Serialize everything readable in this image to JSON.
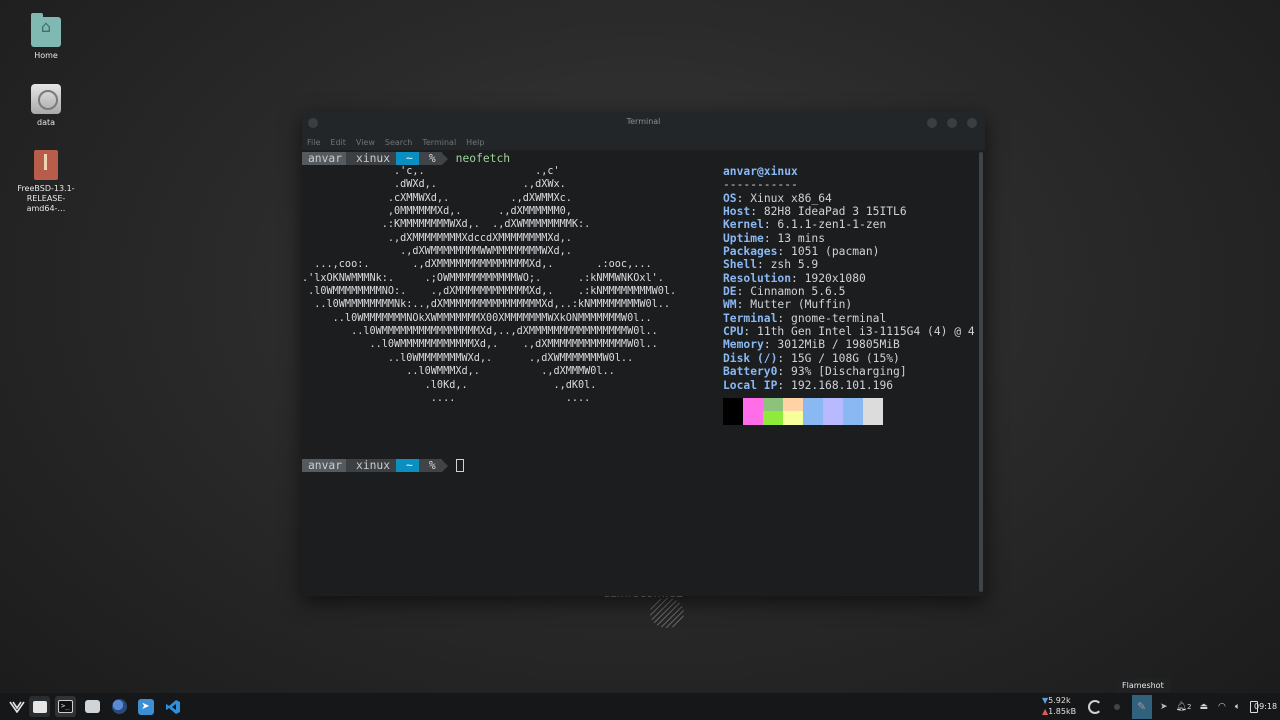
{
  "desktop": {
    "icons": [
      {
        "label": "Home"
      },
      {
        "label": "data"
      },
      {
        "label": "FreeBSD-13.1-RELEASE-amd64-…"
      }
    ],
    "watermark": "uzinfocom.uz"
  },
  "terminal": {
    "title": "Terminal",
    "menu": [
      "File",
      "Edit",
      "View",
      "Search",
      "Terminal",
      "Help"
    ],
    "prompt": {
      "user": "anvar",
      "host": "xinux",
      "dir": "~",
      "symbol": "%"
    },
    "command": "neofetch",
    "ascii_art": "               .'c,.                  .,c'\n               .dWXd,.              .,dXWx.\n              .cXMMWXd,.          .,dXWMMXc.\n              ,0MMMMMMXd,.      .,dXMMMMMM0,\n             .:KMMMMMMMMWXd,.  .,dXWMMMMMMMMK:.\n              .,dXMMMMMMMMXdccdXMMMMMMMMXd,.\n                .,dXWMMMMMMMMWWMMMMMMMMWXd,.\n  ...,coo:.       .,dXMMMMMMMMMMMMMMMXd,.       .:ooc,...\n.'lxOKNWMMMNk:.     .;OWMMMMMMMMMMMWO;.      .:kNMMWNKOxl'.\n .l0WMMMMMMMMNO:.    .,dXMMMMMMMMMMMMXd,.    .:kNMMMMMMMMW0l.\n  ..l0WMMMMMMMMNk:..,dXMMMMMMMMMMMMMMMMXd,..:kNMMMMMMMMW0l..\n     ..l0WMMMMMMMNOkXWMMMMMMMX00XMMMMMMMWXkONMMMMMMMW0l..\n        ..l0WMMMMMMMMMMMMMMMMXd,..,dXMMMMMMMMMMMMMMMMW0l..\n           ..l0WMMMMMMMMMMMMXd,.    .,dXMMMMMMMMMMMMMW0l..\n              ..l0WMMMMMMMWXd,.      .,dXWMMMMMMMW0l..\n                 ..l0WMMMXd,.          .,dXMMMW0l..\n                    .l0Kd,.              .,dK0l.\n                     ....                  ....",
    "header": "anvar@xinux",
    "separator": "-----------",
    "info": [
      {
        "key": "OS",
        "value": "Xinux x86_64"
      },
      {
        "key": "Host",
        "value": "82H8 IdeaPad 3 15ITL6"
      },
      {
        "key": "Kernel",
        "value": "6.1.1-zen1-1-zen"
      },
      {
        "key": "Uptime",
        "value": "13 mins"
      },
      {
        "key": "Packages",
        "value": "1051 (pacman)"
      },
      {
        "key": "Shell",
        "value": "zsh 5.9"
      },
      {
        "key": "Resolution",
        "value": "1920x1080"
      },
      {
        "key": "DE",
        "value": "Cinnamon 5.6.5"
      },
      {
        "key": "WM",
        "value": "Mutter (Muffin)"
      },
      {
        "key": "Terminal",
        "value": "gnome-terminal"
      },
      {
        "key": "CPU",
        "value": "11th Gen Intel i3-1115G4 (4) @ 4"
      },
      {
        "key": "Memory",
        "value": "3012MiB / 19805MiB"
      },
      {
        "key": "Disk (/)",
        "value": "15G / 108G (15%)"
      },
      {
        "key": "Battery0",
        "value": "93% [Discharging]"
      },
      {
        "key": "Local IP",
        "value": "192.168.101.196"
      }
    ],
    "palette_top": [
      "#000000",
      "#ff6ee8",
      "#8dc27a",
      "#ffd3a5",
      "#8ab8f2",
      "#b9b9ff",
      "#8ab8f2",
      "#dcdcdc"
    ],
    "palette_bottom": [
      "#000000",
      "#ff6ee8",
      "#8fea3b",
      "#f7ff9a",
      "#8ab8f2",
      "#b9b9ff",
      "#8ab8f2",
      "#dcdcdc"
    ]
  },
  "taskbar": {
    "network_down": "5.92k",
    "network_up": "1.85kB",
    "tooltip": "Flameshot",
    "notifications": "2",
    "clock": "09:18",
    "accent": "#4a9fd0"
  }
}
